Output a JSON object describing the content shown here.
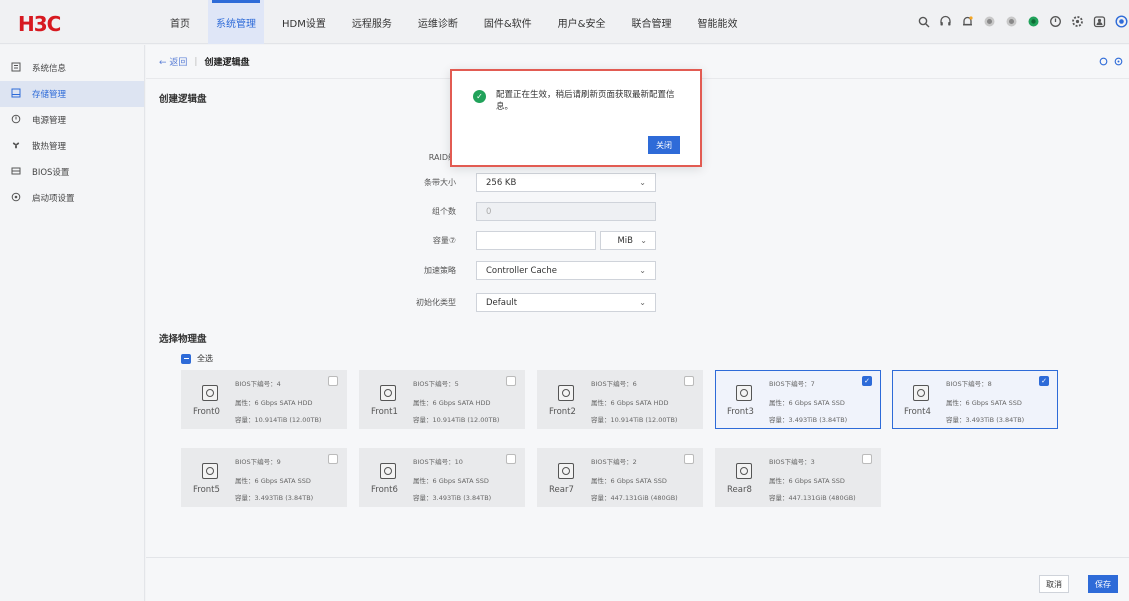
{
  "app": {
    "logo": "H3C"
  },
  "nav": [
    {
      "label": "首页"
    },
    {
      "label": "系统管理",
      "active": true
    },
    {
      "label": "HDM设置"
    },
    {
      "label": "远程服务"
    },
    {
      "label": "运维诊断"
    },
    {
      "label": "固件&软件"
    },
    {
      "label": "用户&安全"
    },
    {
      "label": "联合管理"
    },
    {
      "label": "智能能效"
    }
  ],
  "top_icons": [
    "search-icon",
    "headset-icon",
    "bell-icon",
    "status-icon",
    "status-icon",
    "health-icon",
    "power-icon",
    "settings-icon",
    "account-icon",
    "help-icon"
  ],
  "sidebar": {
    "items": [
      {
        "label": "系统信息",
        "icon": "list-icon"
      },
      {
        "label": "存储管理",
        "icon": "storage-icon",
        "active": true
      },
      {
        "label": "电源管理",
        "icon": "power-icon"
      },
      {
        "label": "散热管理",
        "icon": "fan-icon"
      },
      {
        "label": "BIOS设置",
        "icon": "bios-icon"
      },
      {
        "label": "启动项设置",
        "icon": "boot-icon"
      }
    ]
  },
  "breadcrumb": {
    "back": "← 返回",
    "separator": "|",
    "current": "创建逻辑盘"
  },
  "form": {
    "section_title": "创建逻辑盘",
    "rows": [
      {
        "label": "RAID级",
        "value": ""
      },
      {
        "label": "条带大小",
        "value": "256 KB"
      },
      {
        "label": "组个数",
        "value": "0"
      },
      {
        "label": "容量⑦",
        "value": "",
        "unit": "MiB"
      },
      {
        "label": "加速策略",
        "value": "Controller Cache"
      },
      {
        "label": "初始化类型",
        "value": "Default"
      }
    ]
  },
  "disks": {
    "section_title": "选择物理盘",
    "select_all": "全选",
    "items": [
      {
        "slot": "Front0",
        "bios": "BIOS下编号：4",
        "prop": "属性：6 Gbps SATA HDD",
        "cap": "容量：10.914TiB (12.00TB)",
        "selected": false
      },
      {
        "slot": "Front1",
        "bios": "BIOS下编号：5",
        "prop": "属性：6 Gbps SATA HDD",
        "cap": "容量：10.914TiB (12.00TB)",
        "selected": false
      },
      {
        "slot": "Front2",
        "bios": "BIOS下编号：6",
        "prop": "属性：6 Gbps SATA HDD",
        "cap": "容量：10.914TiB (12.00TB)",
        "selected": false
      },
      {
        "slot": "Front3",
        "bios": "BIOS下编号：7",
        "prop": "属性：6 Gbps SATA SSD",
        "cap": "容量：3.493TiB (3.84TB)",
        "selected": true
      },
      {
        "slot": "Front4",
        "bios": "BIOS下编号：8",
        "prop": "属性：6 Gbps SATA SSD",
        "cap": "容量：3.493TiB (3.84TB)",
        "selected": true
      },
      {
        "slot": "Front5",
        "bios": "BIOS下编号：9",
        "prop": "属性：6 Gbps SATA SSD",
        "cap": "容量：3.493TiB (3.84TB)",
        "selected": false
      },
      {
        "slot": "Front6",
        "bios": "BIOS下编号：10",
        "prop": "属性：6 Gbps SATA SSD",
        "cap": "容量：3.493TiB (3.84TB)",
        "selected": false
      },
      {
        "slot": "Rear7",
        "bios": "BIOS下编号：2",
        "prop": "属性：6 Gbps SATA SSD",
        "cap": "容量：447.131GiB (480GB)",
        "selected": false
      },
      {
        "slot": "Rear8",
        "bios": "BIOS下编号：3",
        "prop": "属性：6 Gbps SATA SSD",
        "cap": "容量：447.131GiB (480GB)",
        "selected": false
      }
    ]
  },
  "footer": {
    "cancel": "取消",
    "save": "保存"
  },
  "modal": {
    "message": "配置正在生效，稍后请刷新页面获取最新配置信息。",
    "close": "关闭"
  }
}
